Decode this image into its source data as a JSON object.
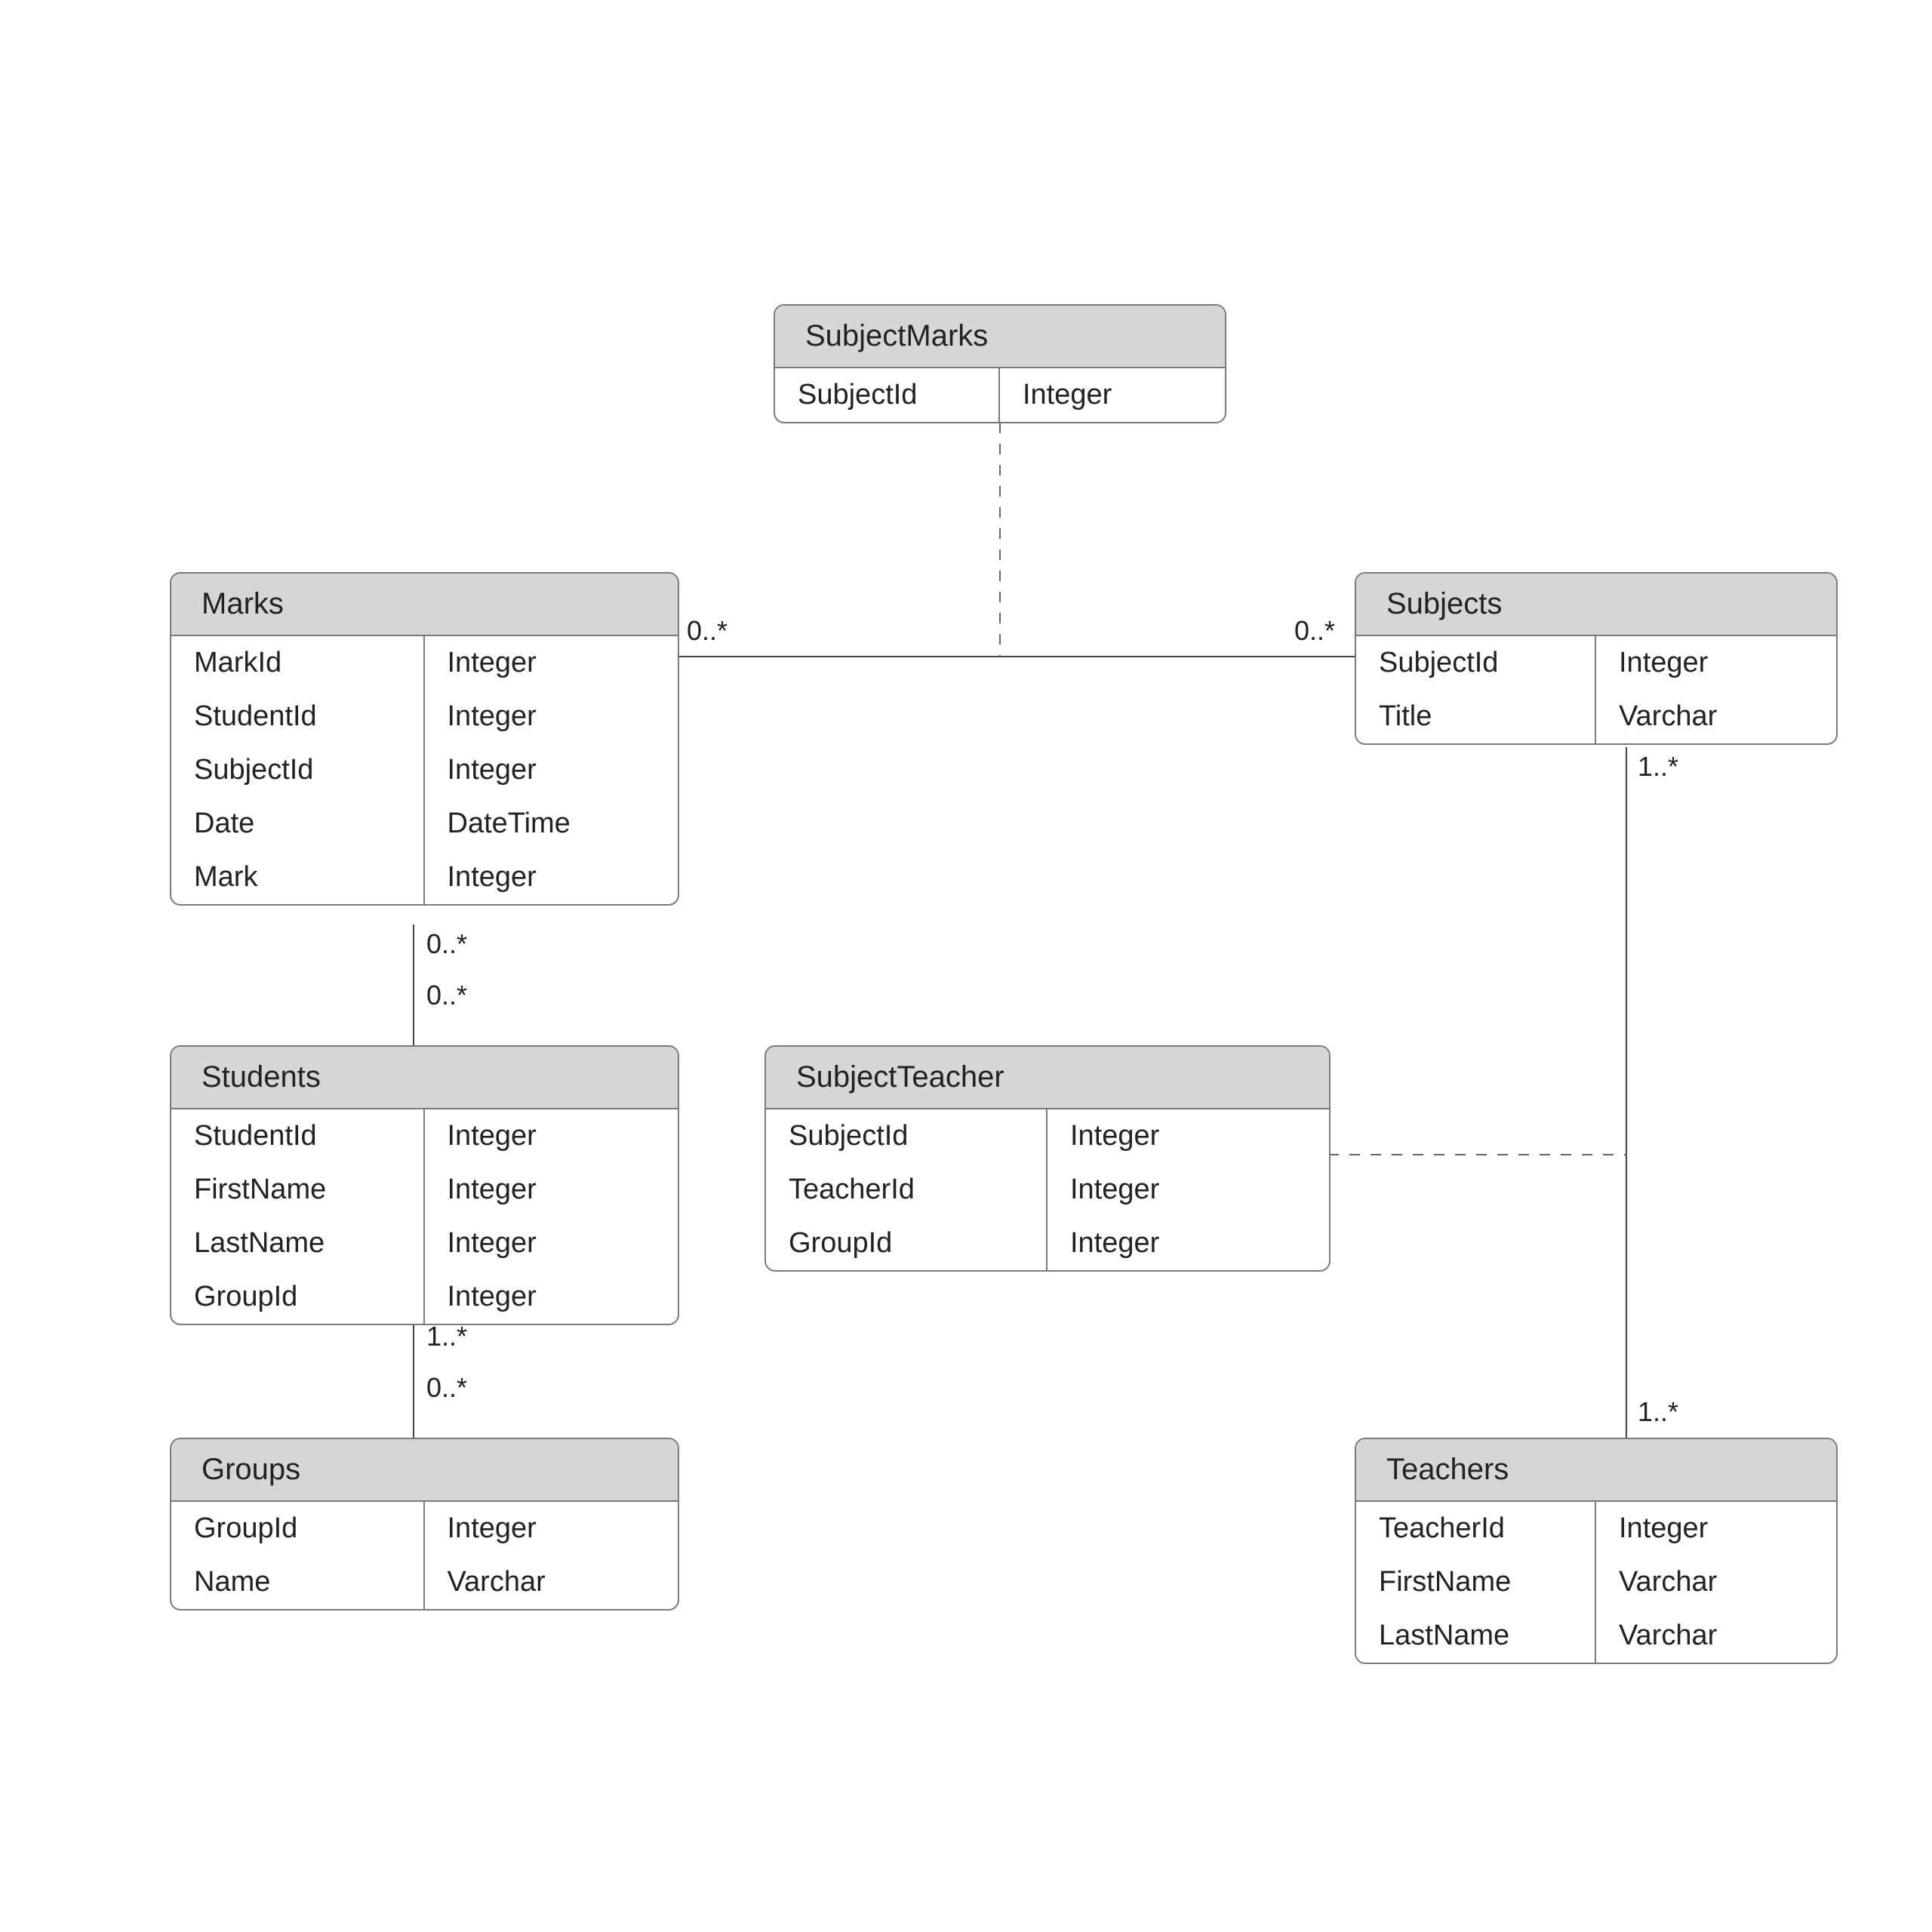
{
  "entities": {
    "subjectMarks": {
      "title": "SubjectMarks",
      "rows": [
        {
          "name": "SubjectId",
          "type": "Integer"
        }
      ]
    },
    "marks": {
      "title": "Marks",
      "rows": [
        {
          "name": "MarkId",
          "type": "Integer"
        },
        {
          "name": "StudentId",
          "type": "Integer"
        },
        {
          "name": "SubjectId",
          "type": "Integer"
        },
        {
          "name": "Date",
          "type": "DateTime"
        },
        {
          "name": "Mark",
          "type": "Integer"
        }
      ]
    },
    "subjects": {
      "title": "Subjects",
      "rows": [
        {
          "name": "SubjectId",
          "type": "Integer"
        },
        {
          "name": "Title",
          "type": "Varchar"
        }
      ]
    },
    "students": {
      "title": "Students",
      "rows": [
        {
          "name": "StudentId",
          "type": "Integer"
        },
        {
          "name": "FirstName",
          "type": "Integer"
        },
        {
          "name": "LastName",
          "type": "Integer"
        },
        {
          "name": "GroupId",
          "type": "Integer"
        }
      ]
    },
    "subjectTeacher": {
      "title": "SubjectTeacher",
      "rows": [
        {
          "name": "SubjectId",
          "type": "Integer"
        },
        {
          "name": "TeacherId",
          "type": "Integer"
        },
        {
          "name": "GroupId",
          "type": "Integer"
        }
      ]
    },
    "groups": {
      "title": "Groups",
      "rows": [
        {
          "name": "GroupId",
          "type": "Integer"
        },
        {
          "name": "Name",
          "type": "Varchar"
        }
      ]
    },
    "teachers": {
      "title": "Teachers",
      "rows": [
        {
          "name": "TeacherId",
          "type": "Integer"
        },
        {
          "name": "FirstName",
          "type": "Varchar"
        },
        {
          "name": "LastName",
          "type": "Varchar"
        }
      ]
    }
  },
  "multiplicities": {
    "marksSubjectsLeft": "0..*",
    "marksSubjectsRight": "0..*",
    "subjectsBottom": "1..*",
    "marksStudentsTop": "0..*",
    "marksStudentsBottom": "0..*",
    "studentsGroupsTop": "1..*",
    "studentsGroupsBottom": "0..*",
    "teachersTop": "1..*"
  }
}
